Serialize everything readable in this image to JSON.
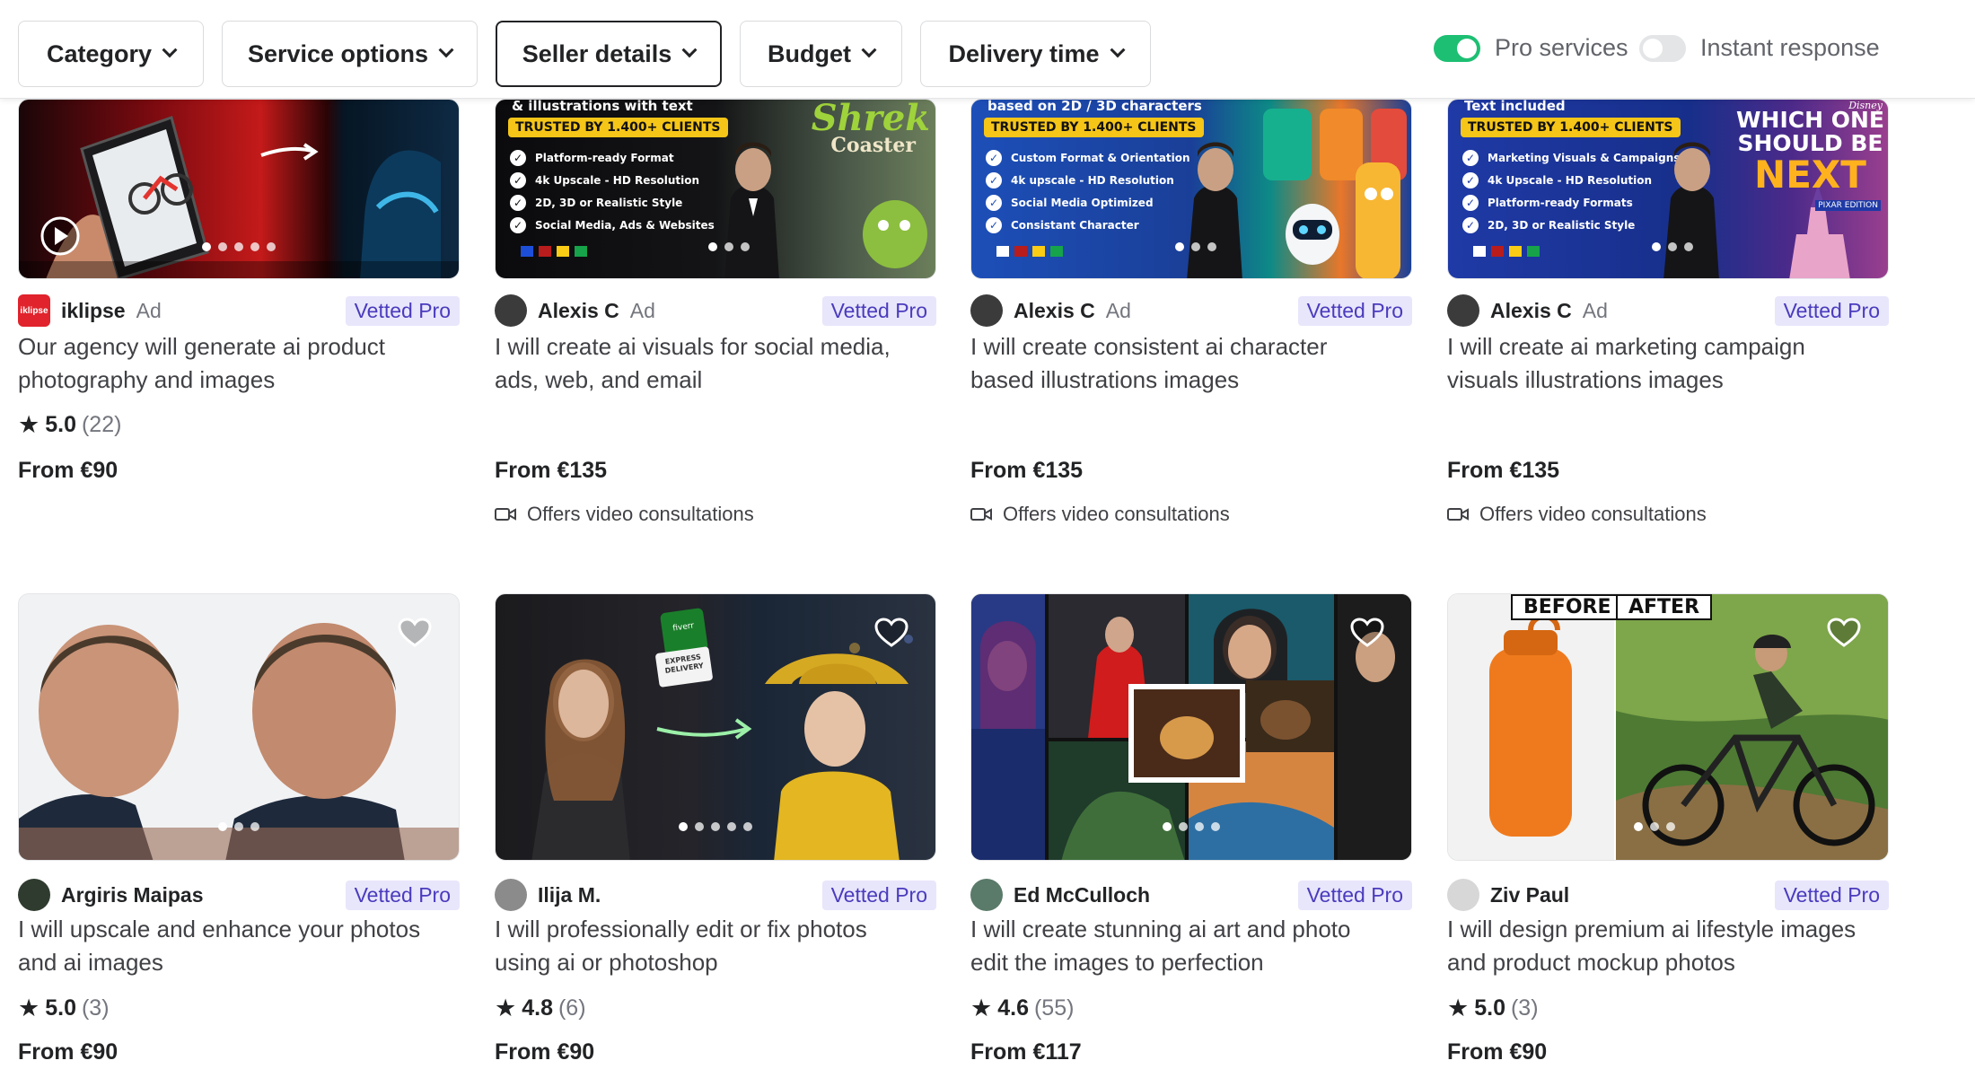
{
  "filters": {
    "category": "Category",
    "service_options": "Service options",
    "seller_details": "Seller details",
    "budget": "Budget",
    "delivery_time": "Delivery time",
    "pro_services": "Pro services",
    "instant_response": "Instant response",
    "pro_services_on": true,
    "instant_response_on": false
  },
  "colors": {
    "vetted_bg": "#e8e6fb",
    "vetted_text": "#4a3bbd",
    "toggle_on": "#1dbf73"
  },
  "row1": [
    {
      "seller": "iklipse",
      "ad": "Ad",
      "badge": "Vetted Pro",
      "title_line1": "Our agency will generate ai product",
      "title_line2": "photography and images",
      "score": "5.0",
      "count": "(22)",
      "price": "From €90",
      "video": ""
    },
    {
      "seller": "Alexis C",
      "ad": "Ad",
      "badge": "Vetted Pro",
      "title_line1": "I will create ai visuals for social media,",
      "title_line2": "ads, web, and email",
      "price": "From €135",
      "video": "Offers video consultations",
      "img_top": "& illustrations with text",
      "img_trust": "TRUSTED BY 1.400+ CLIENTS",
      "img_list": [
        "Platform-ready Format",
        "4k Upscale - HD Resolution",
        "2D, 3D or Realistic Style",
        "Social Media, Ads & Websites"
      ],
      "img_brand_1": "Shrek",
      "img_brand_2": "Coaster"
    },
    {
      "seller": "Alexis C",
      "ad": "Ad",
      "badge": "Vetted Pro",
      "title_line1": "I will create consistent ai character",
      "title_line2": "based illustrations images",
      "price": "From €135",
      "video": "Offers video consultations",
      "img_top": "based on 2D / 3D characters",
      "img_trust": "TRUSTED BY 1.400+ CLIENTS",
      "img_list": [
        "Custom Format & Orientation",
        "4k upscale - HD Resolution",
        "Social Media Optimized",
        "Consistant Character"
      ]
    },
    {
      "seller": "Alexis C",
      "ad": "Ad",
      "badge": "Vetted Pro",
      "title_line1": "I will create ai marketing campaign",
      "title_line2": "visuals illustrations images",
      "price": "From €135",
      "video": "Offers video consultations",
      "img_top": "Text included",
      "img_trust": "TRUSTED BY 1.400+ CLIENTS",
      "img_list": [
        "Marketing Visuals & Campaigns",
        "4k Upscale - HD Resolution",
        "Platform-ready Formats",
        "2D, 3D or Realistic Style"
      ],
      "img_brand_1": "WHICH ONE",
      "img_brand_2": "SHOULD BE",
      "img_brand_3": "NEXT",
      "img_brand_small": "Disney",
      "img_brand_sub": "PIXAR EDITION"
    }
  ],
  "row2": [
    {
      "seller": "Argiris Maipas",
      "badge": "Vetted Pro",
      "title_line1": "I will upscale and enhance your photos",
      "title_line2": "and ai images",
      "score": "5.0",
      "count": "(3)",
      "price": "From €90"
    },
    {
      "seller": "Ilija M.",
      "badge": "Vetted Pro",
      "title_line1": "I will professionally edit or fix photos",
      "title_line2": "using ai or photoshop",
      "score": "4.8",
      "count": "(6)",
      "price": "From €90",
      "img_tag_1": "fiverr",
      "img_tag_2": "EXPRESS",
      "img_tag_3": "DELIVERY"
    },
    {
      "seller": "Ed McCulloch",
      "badge": "Vetted Pro",
      "title_line1": "I will create stunning ai art and photo",
      "title_line2": "edit the images to perfection",
      "score": "4.6",
      "count": "(55)",
      "price": "From €117"
    },
    {
      "seller": "Ziv Paul",
      "badge": "Vetted Pro",
      "title_line1": "I will design premium ai lifestyle images",
      "title_line2": "and product mockup photos",
      "score": "5.0",
      "count": "(3)",
      "price": "From €90",
      "img_before": "BEFORE",
      "img_after": "AFTER"
    }
  ]
}
